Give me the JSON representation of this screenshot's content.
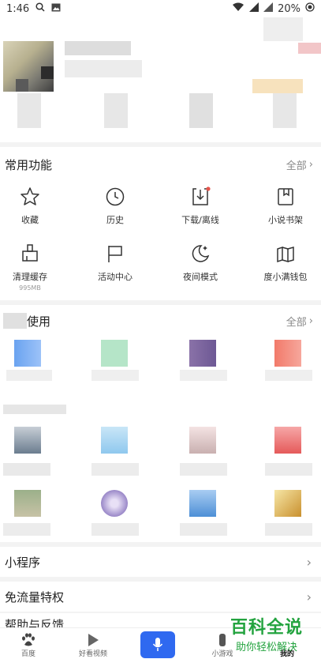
{
  "status_bar": {
    "time": "1:46",
    "battery": "20%"
  },
  "common_functions": {
    "title": "常用功能",
    "more": "全部",
    "items": [
      {
        "label": "收藏",
        "icon": "star-icon"
      },
      {
        "label": "历史",
        "icon": "clock-icon"
      },
      {
        "label": "下载/离线",
        "icon": "download-icon"
      },
      {
        "label": "小说书架",
        "icon": "bookmark-icon"
      },
      {
        "label": "清理缓存",
        "icon": "broom-icon",
        "sub": "995MB"
      },
      {
        "label": "活动中心",
        "icon": "flag-icon"
      },
      {
        "label": "夜间模式",
        "icon": "moon-icon"
      },
      {
        "label": "度小满钱包",
        "icon": "wallet-icon"
      }
    ]
  },
  "recent_use": {
    "title": "使用",
    "more": "全部"
  },
  "rows": [
    {
      "label": "小程序"
    },
    {
      "label": "免流量特权"
    },
    {
      "label": "帮助与反馈"
    }
  ],
  "bottom_nav": {
    "items": [
      {
        "label": "百度",
        "icon": "paw-icon"
      },
      {
        "label": "好看视频",
        "icon": "play-icon"
      },
      {
        "label": "",
        "icon": "mic-icon"
      },
      {
        "label": "小游戏",
        "icon": "game-icon"
      },
      {
        "label": "我的",
        "icon": "user-icon"
      }
    ]
  },
  "watermark": {
    "title": "百科全说",
    "sub": "助你轻松解决"
  },
  "colors": {
    "accent": "#2f69f0",
    "watermark": "#23a33f",
    "notification_dot": "#e5534b"
  }
}
